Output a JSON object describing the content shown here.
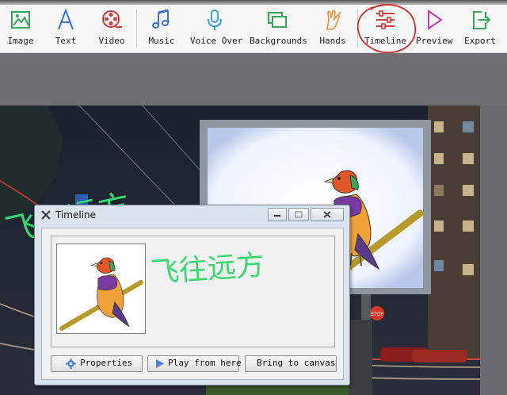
{
  "toolbar": {
    "items": [
      {
        "label": "Image",
        "icon": "image-icon"
      },
      {
        "label": "Text",
        "icon": "text-a-icon"
      },
      {
        "label": "Video",
        "icon": "film-reel-icon"
      },
      {
        "label": "Music",
        "icon": "music-note-icon"
      },
      {
        "label": "Voice Over",
        "icon": "microphone-icon"
      },
      {
        "label": "Backgrounds",
        "icon": "layers-icon"
      },
      {
        "label": "Hands",
        "icon": "hand-pen-icon"
      },
      {
        "label": "Timeline",
        "icon": "sliders-icon"
      },
      {
        "label": "Preview",
        "icon": "play-triangle-icon"
      },
      {
        "label": "Export",
        "icon": "export-arrow-icon"
      }
    ]
  },
  "canvas": {
    "chinese_text": "飞往远方",
    "stop_sign": "STOP"
  },
  "dialog": {
    "title": "Timeline",
    "chinese_text": "飞往远方",
    "buttons": {
      "properties": "Properties",
      "play": "Play from here",
      "bring": "Bring to canvas"
    }
  },
  "colors": {
    "accent_green": "#3ad96f",
    "annotation_red": "#d42a2a",
    "icon_blue": "#3a6fd8"
  }
}
